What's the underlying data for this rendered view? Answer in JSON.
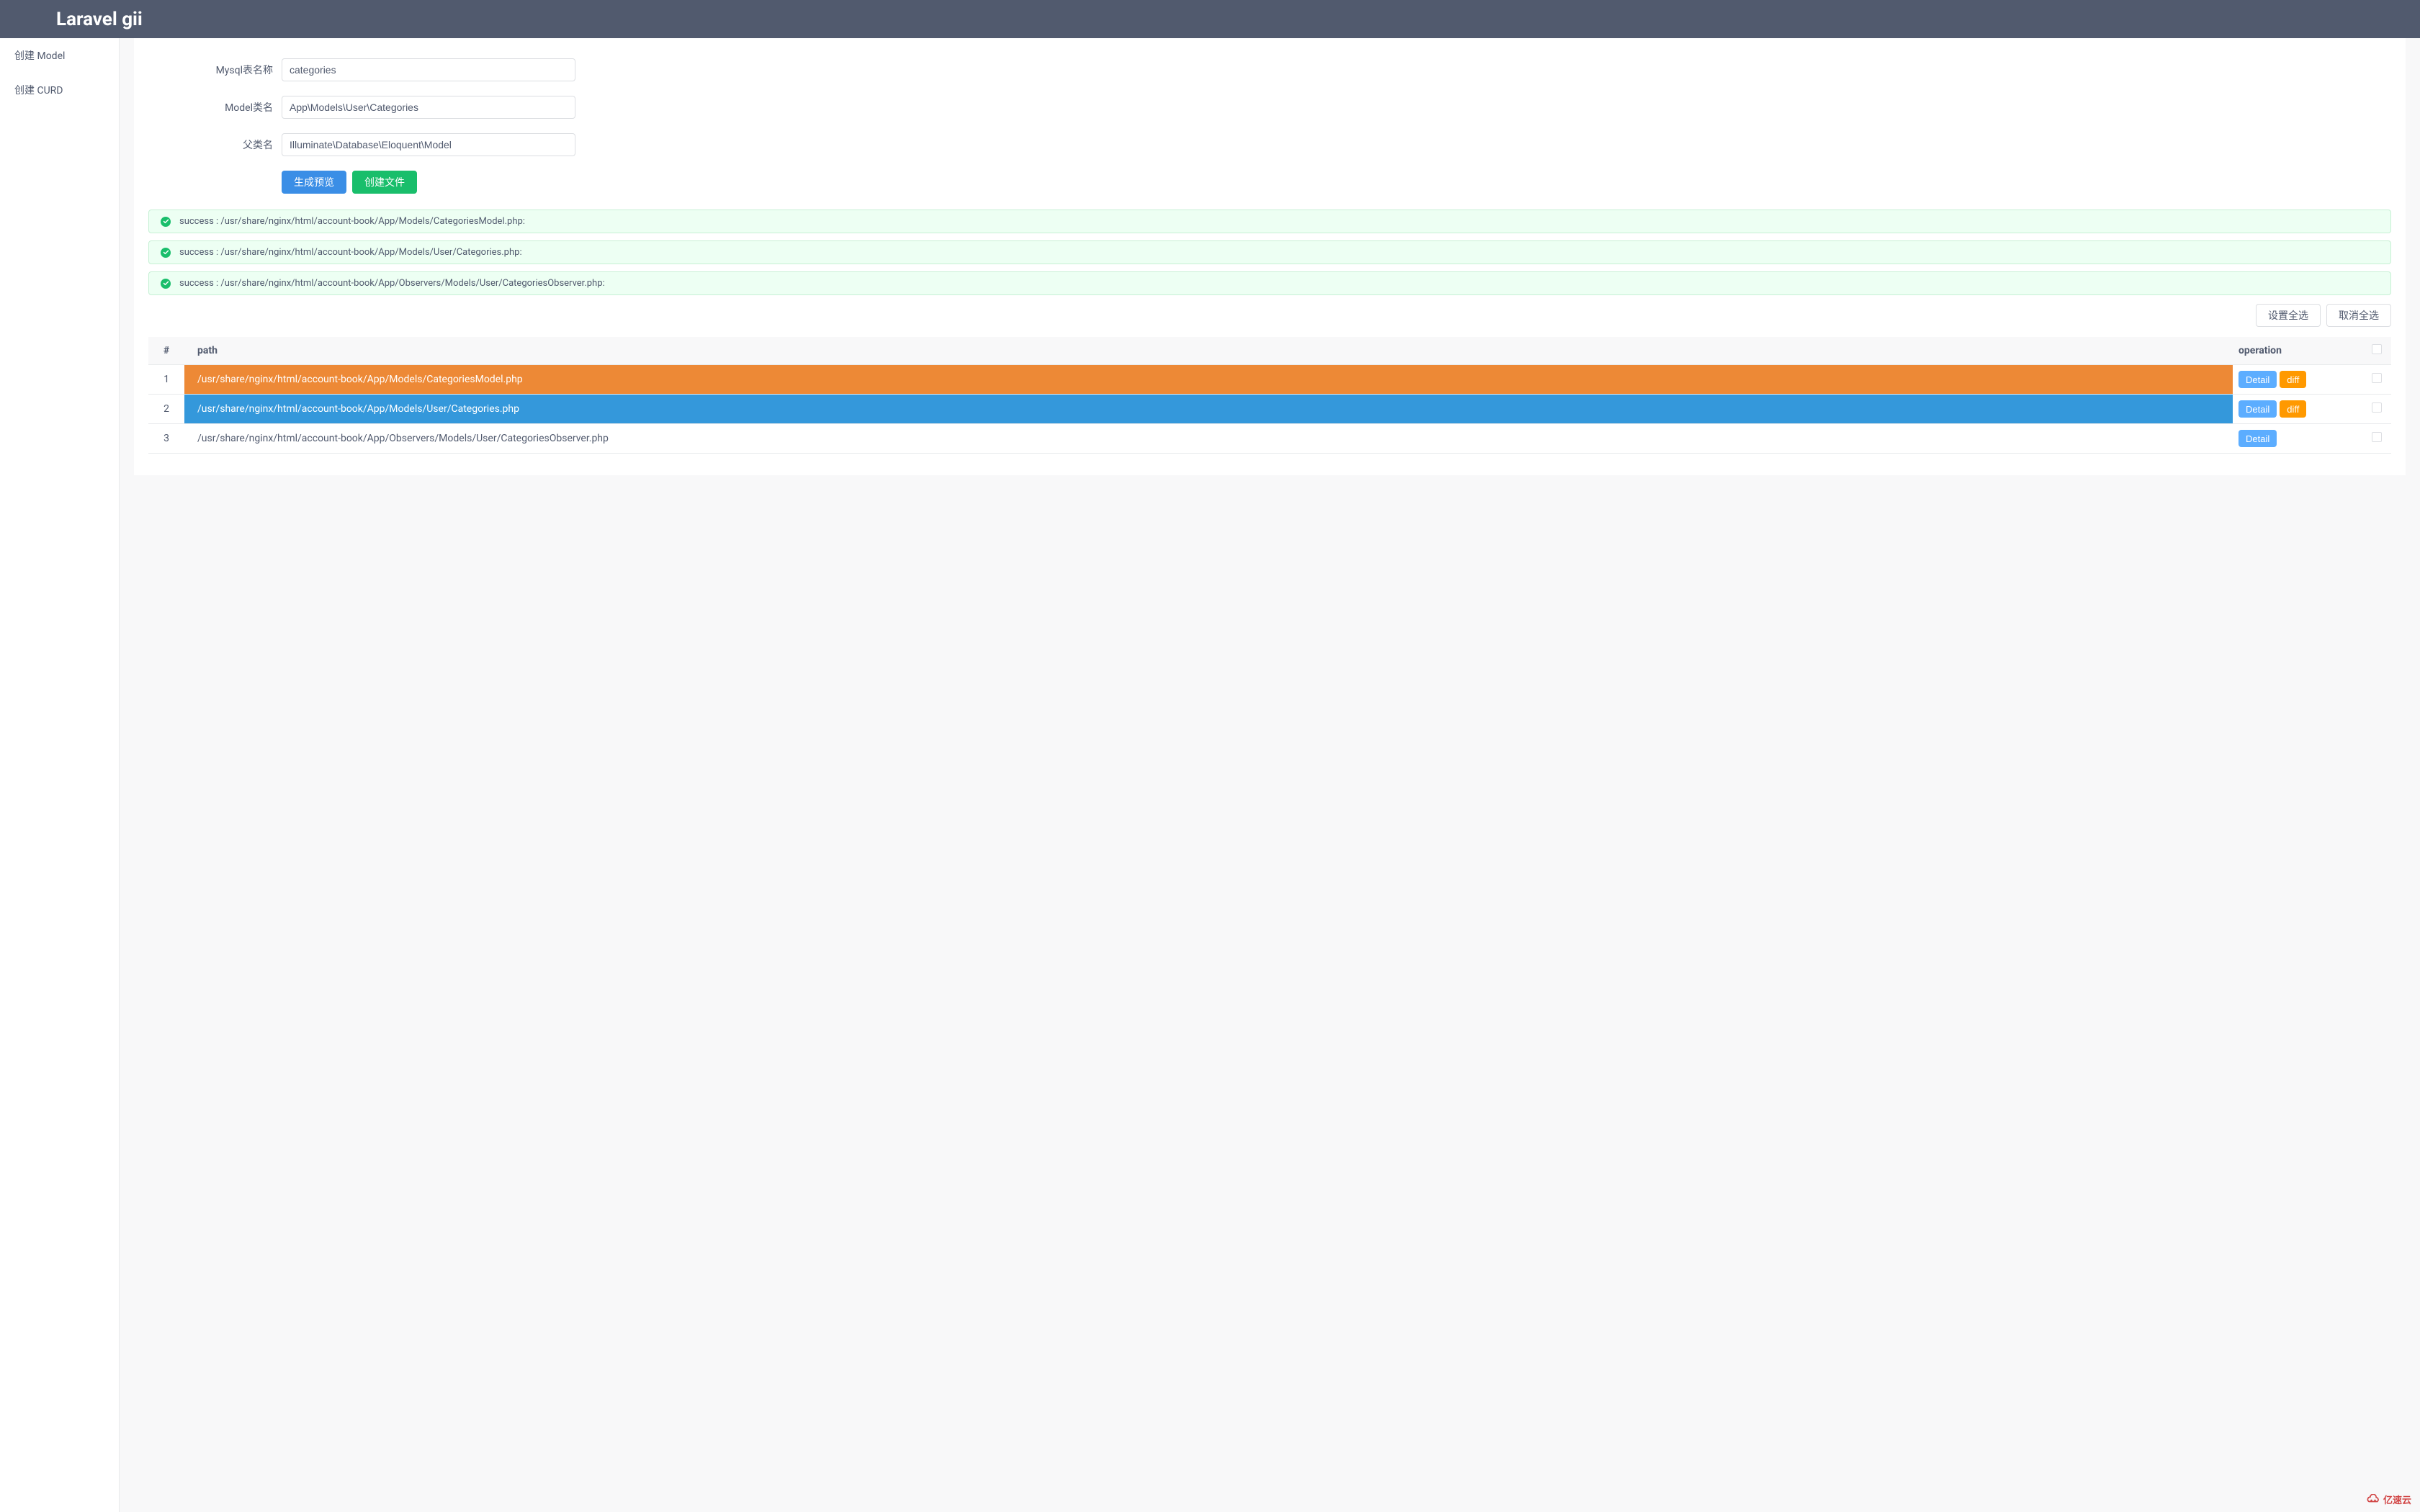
{
  "header": {
    "title": "Laravel gii"
  },
  "sidebar": {
    "items": [
      {
        "label": "创建 Model"
      },
      {
        "label": "创建 CURD"
      }
    ]
  },
  "form": {
    "table_label": "Mysql表名称",
    "table_value": "categories",
    "model_label": "Model类名",
    "model_value": "App\\Models\\User\\Categories",
    "parent_label": "父类名",
    "parent_value": "Illuminate\\Database\\Eloquent\\Model",
    "preview_button": "生成预览",
    "create_button": "创建文件"
  },
  "alerts": [
    {
      "message": "success : /usr/share/nginx/html/account-book/App/Models/CategoriesModel.php:"
    },
    {
      "message": "success : /usr/share/nginx/html/account-book/App/Models/User/Categories.php:"
    },
    {
      "message": "success : /usr/share/nginx/html/account-book/App/Observers/Models/User/CategoriesObserver.php:"
    }
  ],
  "table_actions": {
    "select_all": "设置全选",
    "deselect_all": "取消全选"
  },
  "table": {
    "headers": {
      "num": "#",
      "path": "path",
      "operation": "operation"
    },
    "detail_label": "Detail",
    "diff_label": "diff",
    "rows": [
      {
        "num": "1",
        "path": "/usr/share/nginx/html/account-book/App/Models/CategoriesModel.php",
        "path_class": "path-orange",
        "has_diff": true
      },
      {
        "num": "2",
        "path": "/usr/share/nginx/html/account-book/App/Models/User/Categories.php",
        "path_class": "path-blue",
        "has_diff": true
      },
      {
        "num": "3",
        "path": "/usr/share/nginx/html/account-book/App/Observers/Models/User/CategoriesObserver.php",
        "path_class": "",
        "has_diff": false
      }
    ]
  },
  "watermark": {
    "label": "亿速云"
  }
}
